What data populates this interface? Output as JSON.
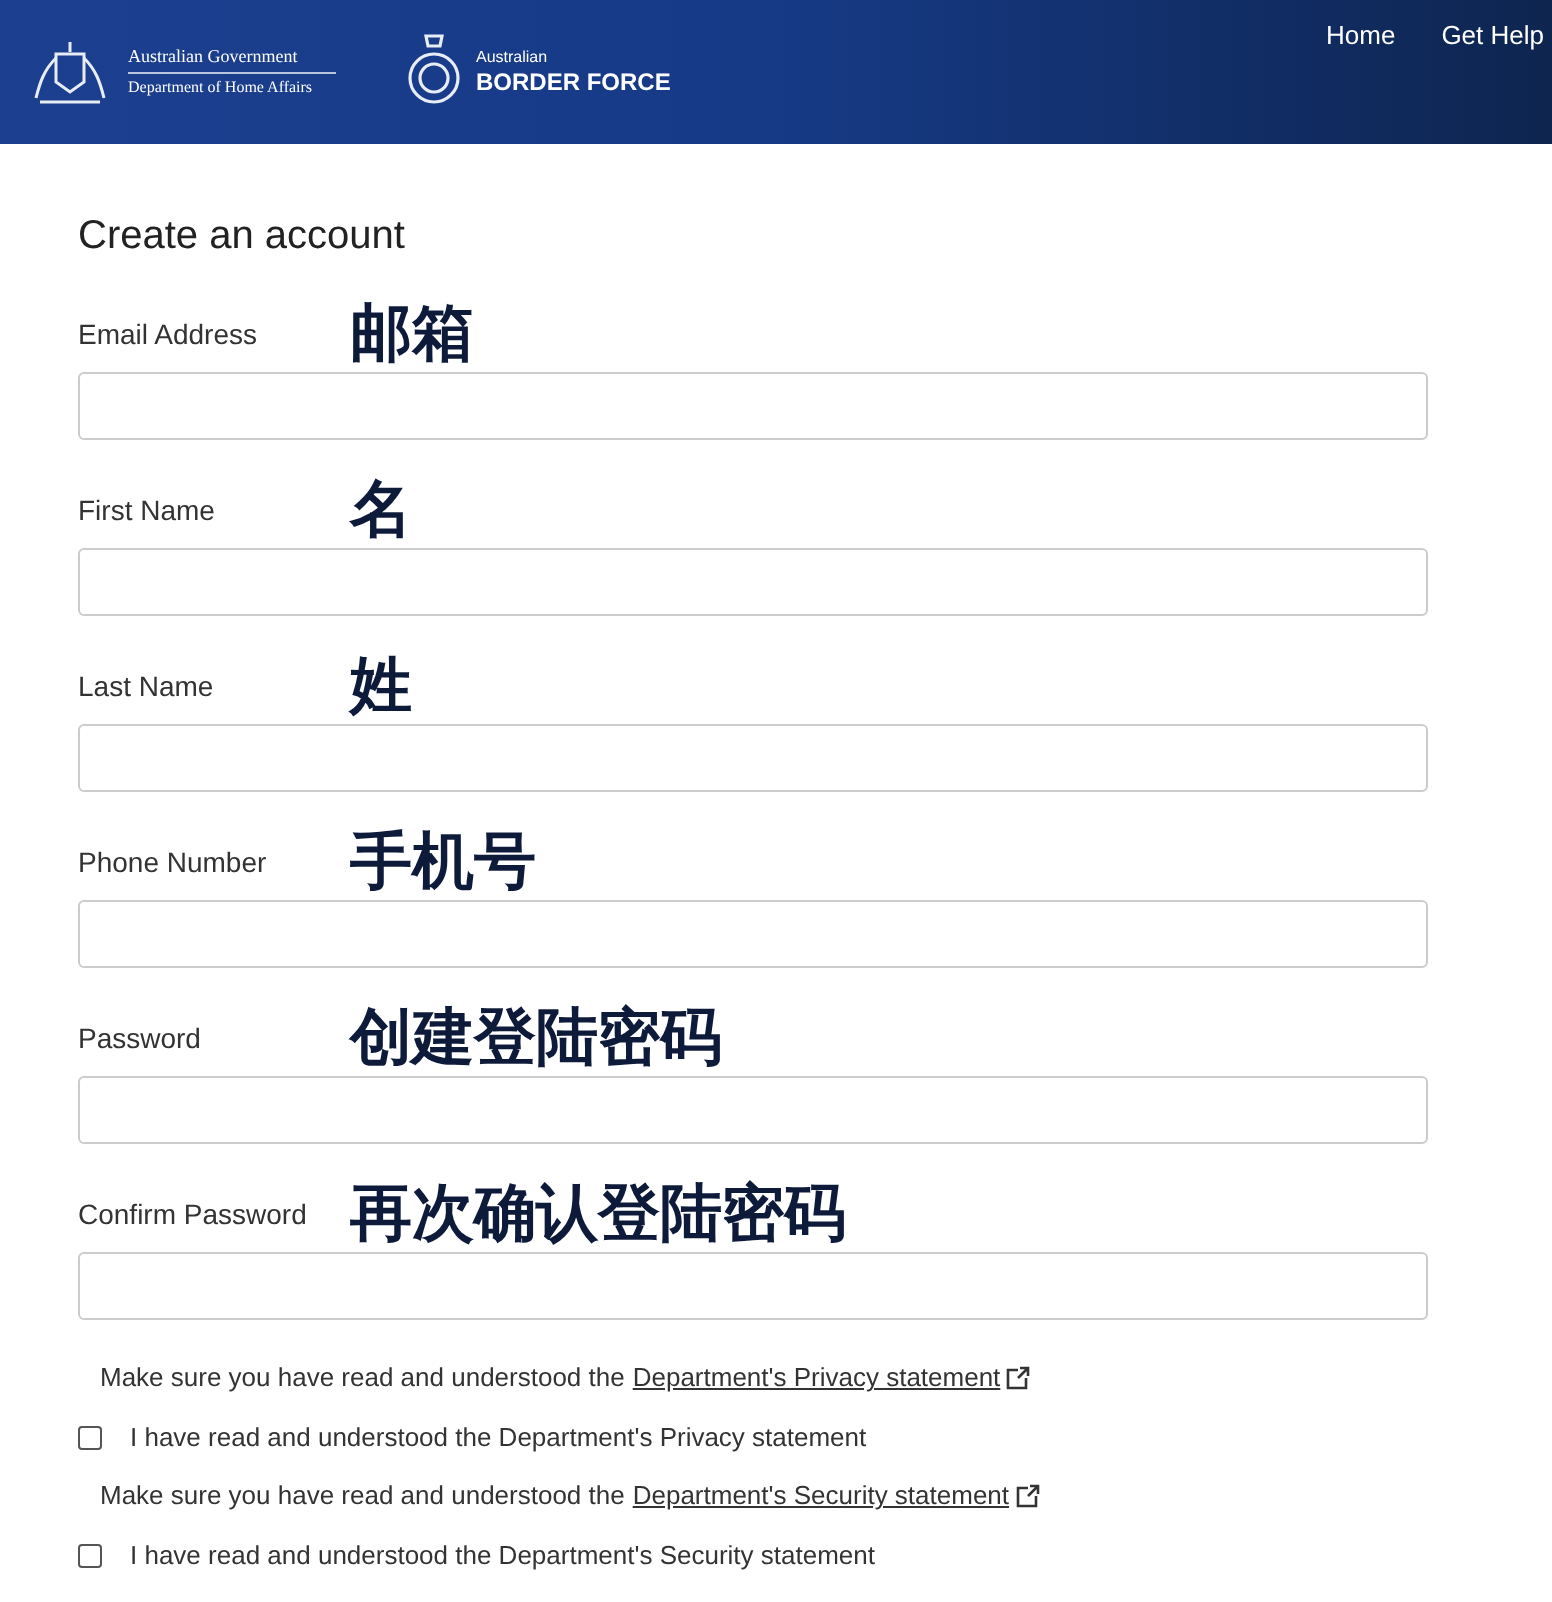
{
  "header": {
    "government": {
      "line_1": "Australian Government",
      "line_2": "Department of Home Affairs"
    },
    "agency": {
      "line_1": "Australian",
      "line_2": "BORDER FORCE"
    },
    "nav": [
      "Home",
      "Get Help"
    ]
  },
  "form": {
    "title": "Create an account",
    "fields": [
      {
        "label": "Email Address",
        "annotation": "邮箱"
      },
      {
        "label": "First Name",
        "annotation": "名"
      },
      {
        "label": "Last Name",
        "annotation": "姓"
      },
      {
        "label": "Phone Number",
        "annotation": "手机号"
      },
      {
        "label": "Password",
        "annotation": "创建登陆密码"
      },
      {
        "label": "Confirm Password",
        "annotation": "再次确认登陆密码"
      }
    ],
    "agreements": [
      {
        "notice": "Make sure you have read and understood the",
        "link": "Department's Privacy statement",
        "checkbox_label": "I have read and understood the Department's Privacy statement",
        "checked": false
      },
      {
        "notice": "Make sure you have read and understood the",
        "link": "Department's Security statement",
        "checkbox_label": "I have read and understood the Department's Security statement",
        "checked": false
      }
    ]
  }
}
